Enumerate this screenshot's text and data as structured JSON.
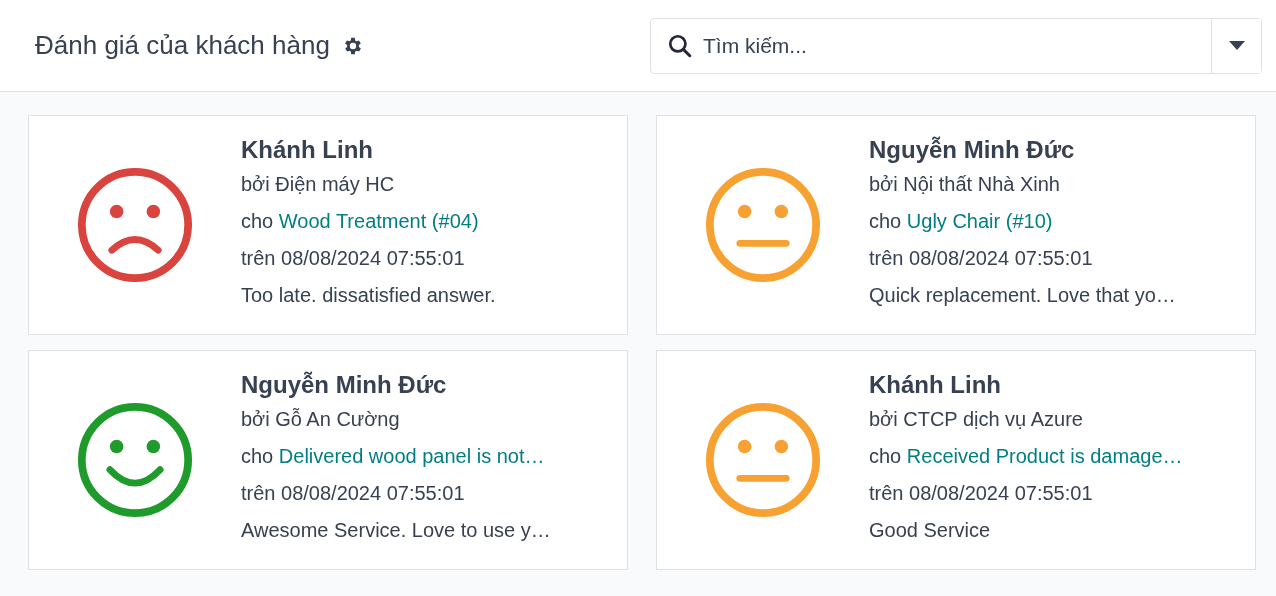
{
  "header": {
    "title": "Đánh giá của khách hàng",
    "search": {
      "placeholder": "Tìm kiếm..."
    }
  },
  "ratings": [
    {
      "kind": "sad",
      "color": "#d9443e",
      "name": "Khánh Linh",
      "by": "bởi Điện máy HC",
      "for_prefix": "cho",
      "for_link": "Wood Treatment (#04)",
      "on": "trên 08/08/2024 07:55:01",
      "comment": "Too late. dissatisfied answer."
    },
    {
      "kind": "neutral",
      "color": "#f7a132",
      "name": "Nguyễn Minh Đức",
      "by": "bởi Nội thất Nhà Xinh",
      "for_prefix": "cho",
      "for_link": "Ugly Chair (#10)",
      "on": "trên 08/08/2024 07:55:01",
      "comment": "Quick replacement. Love that yo…"
    },
    {
      "kind": "happy",
      "color": "#1e9b2b",
      "name": "Nguyễn Minh Đức",
      "by": "bởi Gỗ An Cường",
      "for_prefix": "cho",
      "for_link": "Delivered wood panel is not…",
      "on": "trên 08/08/2024 07:55:01",
      "comment": "Awesome Service. Love to use y…"
    },
    {
      "kind": "neutral",
      "color": "#f7a132",
      "name": "Khánh Linh",
      "by": "bởi CTCP dịch vụ Azure",
      "for_prefix": "cho",
      "for_link": "Received Product is damage…",
      "on": "trên 08/08/2024 07:55:01",
      "comment": "Good Service"
    }
  ]
}
